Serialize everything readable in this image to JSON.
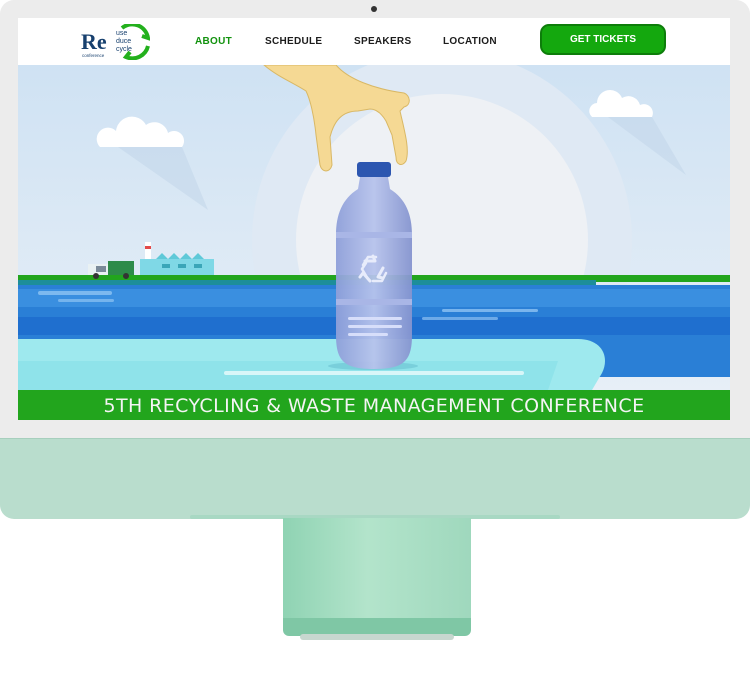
{
  "logo": {
    "main": "Re",
    "lines": [
      "use",
      "duce",
      "cycle"
    ],
    "sub": "conference"
  },
  "nav": {
    "items": [
      {
        "label": "ABOUT",
        "active": true
      },
      {
        "label": "SCHEDULE",
        "active": false
      },
      {
        "label": "SPEAKERS",
        "active": false
      },
      {
        "label": "LOCATION",
        "active": false
      }
    ],
    "cta": "GET TICKETS"
  },
  "hero": {
    "headline": "5TH RECYCLING & WASTE MANAGEMENT CONFERENCE"
  },
  "colors": {
    "accent": "#14a80e",
    "active_link": "#12920e",
    "chin": "#b9ddcd",
    "banner": "#22a51d"
  },
  "icons": [
    "recycle-icon",
    "truck-icon",
    "factory-icon",
    "cloud-icon",
    "hand-icon",
    "bottle-icon"
  ]
}
